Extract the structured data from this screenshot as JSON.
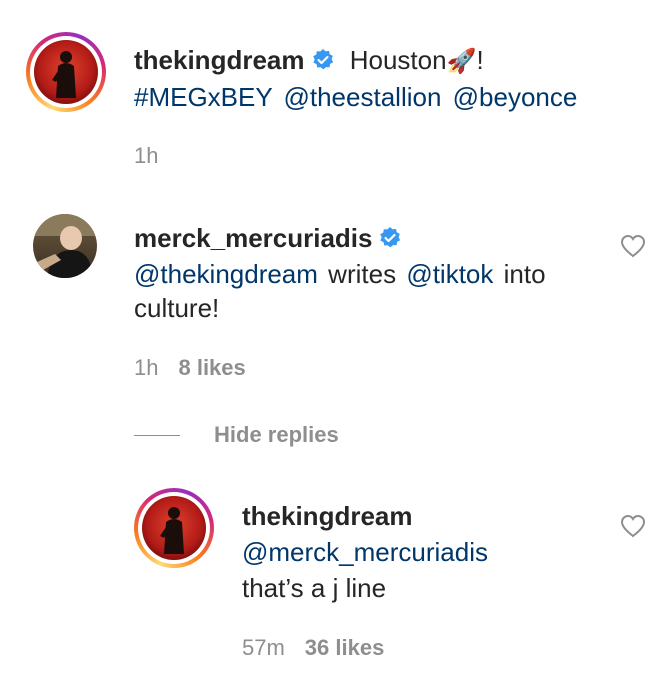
{
  "post": {
    "username": "thekingdream",
    "caption_text": "Houston",
    "caption_emoji": "🚀",
    "caption_end": "!",
    "hashtag": "#MEGxBEY",
    "mention_1": "@theestallion",
    "mention_2": "@beyonce",
    "time": "1h"
  },
  "comment": {
    "username": "merck_mercuriadis",
    "mention_1": "@thekingdream",
    "text_1": "writes",
    "mention_2": "@tiktok",
    "text_2": "into",
    "text_3": "culture!",
    "time": "1h",
    "likes": "8 likes"
  },
  "toggle": {
    "label": "Hide replies"
  },
  "reply": {
    "username": "thekingdream",
    "mention": "@merck_mercuriadis",
    "text": "that’s a j line",
    "time": "57m",
    "likes": "36 likes"
  },
  "colors": {
    "link": "#00376b",
    "muted": "#8e8e8e",
    "verified": "#3897f0",
    "text": "#262626"
  },
  "icons": {
    "verified": "verified-badge-icon",
    "heart": "heart-outline-icon"
  }
}
